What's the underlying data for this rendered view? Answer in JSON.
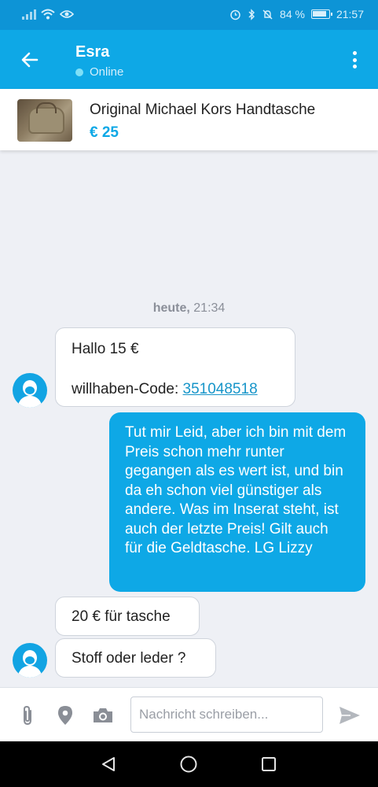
{
  "statusbar": {
    "battery_text": "84 %",
    "time": "21:57",
    "icons": [
      "signal-icon",
      "wifi-icon",
      "eye-icon",
      "alarm-icon",
      "bluetooth-icon",
      "mute-icon",
      "battery-icon"
    ]
  },
  "header": {
    "contact_name": "Esra",
    "status": "Online"
  },
  "listing": {
    "title": "Original Michael Kors Handtasche",
    "price": "€ 25"
  },
  "chat": {
    "date_label_day": "heute,",
    "date_label_time": "21:34",
    "messages": [
      {
        "direction": "in",
        "line1": "Hallo 15 €",
        "code_label": "willhaben-Code:",
        "code_value": "351048518"
      },
      {
        "direction": "out",
        "text": "Tut mir Leid, aber ich bin mit dem Preis schon mehr runter gegangen als es wert ist, und bin da eh schon viel günstiger als andere. Was im Inserat steht, ist auch der letzte Preis! Gilt auch für die Geldtasche. LG Lizzy"
      },
      {
        "direction": "in",
        "text": "20 € für tasche"
      },
      {
        "direction": "in",
        "text": "Stoff oder leder ?"
      }
    ]
  },
  "composer": {
    "placeholder": "Nachricht schreiben..."
  },
  "colors": {
    "brand": "#0ea8e6",
    "statusbar": "#0d94d6",
    "online_dot": "#7fe0f7"
  }
}
